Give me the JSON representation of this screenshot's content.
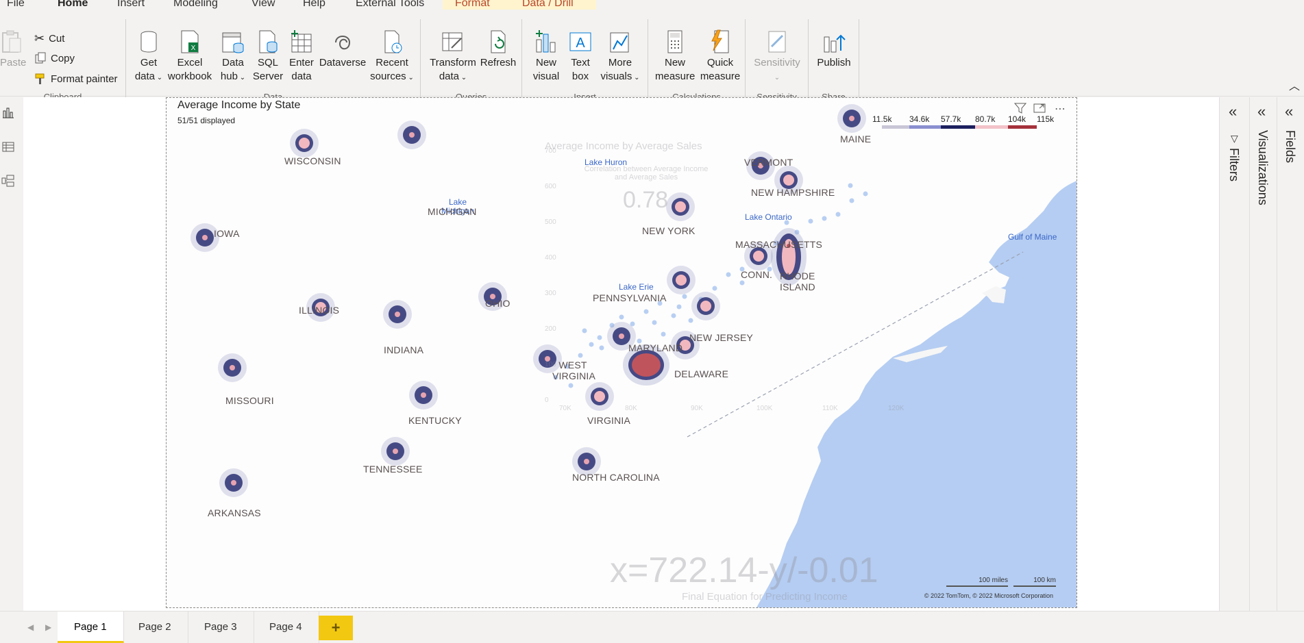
{
  "menu": {
    "file": "File",
    "home": "Home",
    "insert": "Insert",
    "modeling": "Modeling",
    "view": "View",
    "help": "Help",
    "external_tools": "External Tools",
    "format": "Format",
    "data_drill": "Data / Drill"
  },
  "ribbon": {
    "clipboard": {
      "label": "Clipboard",
      "paste": "Paste",
      "cut": "Cut",
      "copy": "Copy",
      "format_painter": "Format painter"
    },
    "data": {
      "label": "Data",
      "get_data": [
        "Get",
        "data"
      ],
      "excel": [
        "Excel",
        "workbook"
      ],
      "data_hub": [
        "Data",
        "hub"
      ],
      "sql": [
        "SQL",
        "Server"
      ],
      "enter": [
        "Enter",
        "data"
      ],
      "dataverse": "Dataverse",
      "recent": [
        "Recent",
        "sources"
      ]
    },
    "queries": {
      "label": "Queries",
      "transform": [
        "Transform",
        "data"
      ],
      "refresh": "Refresh"
    },
    "insert": {
      "label": "Insert",
      "new_visual": [
        "New",
        "visual"
      ],
      "text_box": [
        "Text",
        "box"
      ],
      "more_visuals": [
        "More",
        "visuals"
      ]
    },
    "calculations": {
      "label": "Calculations",
      "new_measure": [
        "New",
        "measure"
      ],
      "quick_measure": [
        "Quick",
        "measure"
      ]
    },
    "sensitivity": {
      "label": "Sensitivity",
      "btn": "Sensitivity"
    },
    "share": {
      "label": "Share",
      "publish": "Publish"
    }
  },
  "visual": {
    "title": "Average Income by State",
    "subtitle": "51/51 displayed",
    "legend": [
      "11.5k",
      "34.6k",
      "57.7k",
      "80.7k",
      "104k",
      "115k"
    ],
    "legend_colors": [
      "#c8c6d6",
      "#8a8fd0",
      "#1c1f5e",
      "#f2c2c8",
      "#a4313b"
    ],
    "states": [
      {
        "name": "WISCONSIN"
      },
      {
        "name": "MICHIGAN"
      },
      {
        "name": "IOWA"
      },
      {
        "name": "ILLINOIS"
      },
      {
        "name": "INDIANA"
      },
      {
        "name": "OHIO"
      },
      {
        "name": "MISSOURI"
      },
      {
        "name": "KENTUCKY"
      },
      {
        "name": "TENNESSEE"
      },
      {
        "name": "ARKANSAS"
      },
      {
        "name": "WEST VIRGINIA"
      },
      {
        "name": "VIRGINIA"
      },
      {
        "name": "NORTH CAROLINA"
      },
      {
        "name": "MARYLAND"
      },
      {
        "name": "DELAWARE"
      },
      {
        "name": "NEW JERSEY"
      },
      {
        "name": "PENNSYLVANIA"
      },
      {
        "name": "NEW YORK"
      },
      {
        "name": "MASSACHUSETTS"
      },
      {
        "name": "CONN."
      },
      {
        "name": "RHODE ISLAND"
      },
      {
        "name": "VERMONT"
      },
      {
        "name": "NEW HAMPSHIRE"
      },
      {
        "name": "MAINE"
      }
    ],
    "water": {
      "lake_huron": "Lake Huron",
      "lake_michigan": "Lake Michigan",
      "lake_ontario": "Lake Ontario",
      "lake_erie": "Lake Erie",
      "gulf_of_maine": "Gulf of Maine"
    },
    "ghost": {
      "chart_title": "Average Income by Average Sales",
      "chart_sub": "Correlation between Average Income and Average Sales",
      "corr": "0.78",
      "equation": "x=722.14-y/-0.01",
      "equation_caption": "Final Equation for Predicting Income",
      "y_ticks": [
        "700",
        "600",
        "500",
        "400",
        "300",
        "200",
        "100",
        "0"
      ],
      "x_ticks": [
        "70K",
        "80K",
        "90K",
        "100K",
        "110K",
        "120K"
      ]
    },
    "scale_miles": "100 miles",
    "scale_km": "100 km",
    "copyright": "© 2022 TomTom, © 2022 Microsoft Corporation"
  },
  "panes": {
    "filters": "Filters",
    "visualizations": "Visualizations",
    "fields": "Fields"
  },
  "pages": {
    "tabs": [
      "Page 1",
      "Page 2",
      "Page 3",
      "Page 4"
    ],
    "active": "Page 1",
    "add": "+"
  }
}
